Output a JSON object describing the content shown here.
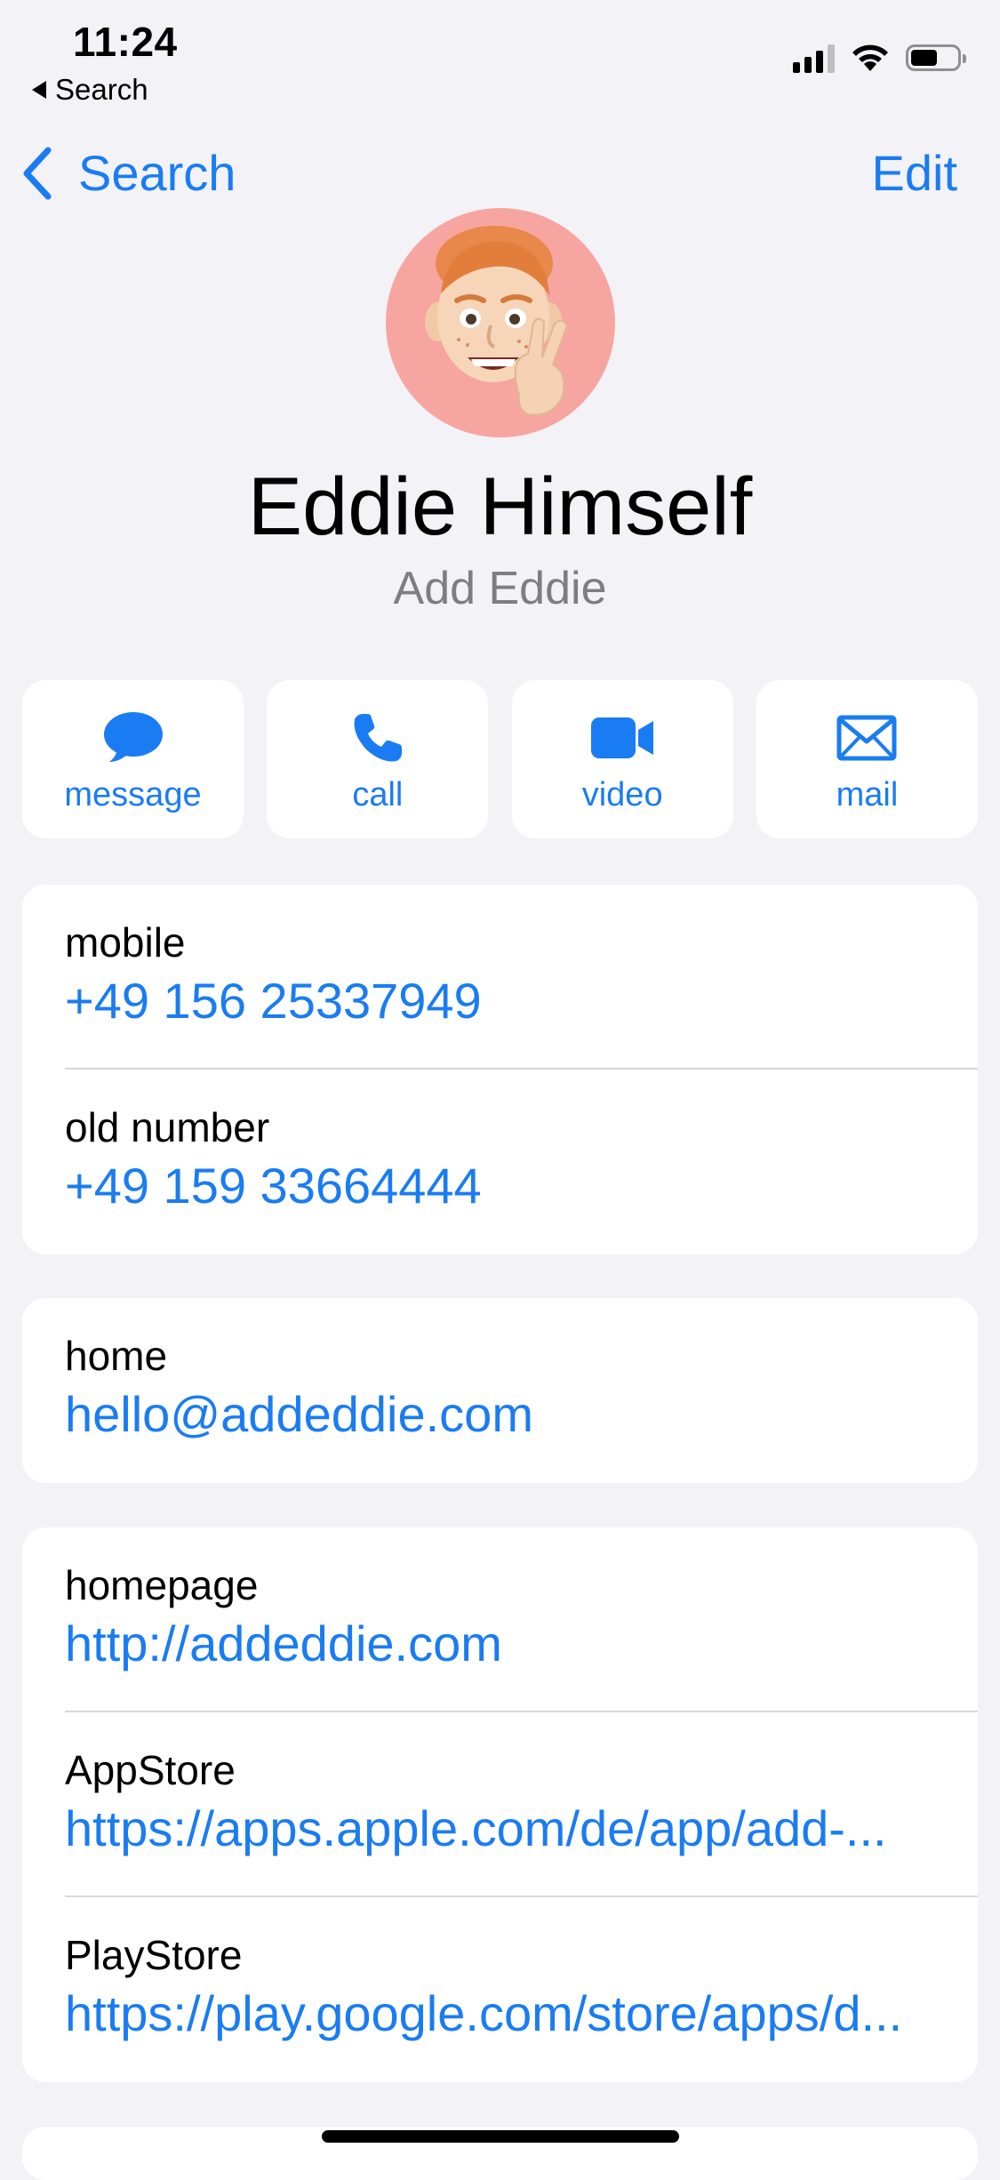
{
  "status_bar": {
    "time": "11:24",
    "back_app_label": "Search",
    "signal_icon": "cellular-signal-icon",
    "wifi_icon": "wifi-icon",
    "battery_icon": "battery-icon",
    "battery_level": 0.5
  },
  "nav": {
    "back_label": "Search",
    "edit_label": "Edit"
  },
  "contact": {
    "avatar_icon": "memoji-avatar",
    "avatar_bg": "#f7a5a0",
    "name": "Eddie Himself",
    "company": "Add Eddie"
  },
  "actions": [
    {
      "label": "message",
      "icon": "message-bubble-icon"
    },
    {
      "label": "call",
      "icon": "phone-icon"
    },
    {
      "label": "video",
      "icon": "video-camera-icon"
    },
    {
      "label": "mail",
      "icon": "envelope-icon"
    }
  ],
  "phones": [
    {
      "label": "mobile",
      "value": "+49 156 25337949"
    },
    {
      "label": "old number",
      "value": "+49 159 33664444"
    }
  ],
  "emails": [
    {
      "label": "home",
      "value": "hello@addeddie.com"
    }
  ],
  "urls": [
    {
      "label": "homepage",
      "value": "http://addeddie.com"
    },
    {
      "label": "AppStore",
      "value": "https://apps.apple.com/de/app/add-..."
    },
    {
      "label": "PlayStore",
      "value": "https://play.google.com/store/apps/d..."
    }
  ],
  "colors": {
    "accent": "#1a7cf2",
    "background": "#f2f2f7",
    "secondary_text": "#7d7d82"
  }
}
